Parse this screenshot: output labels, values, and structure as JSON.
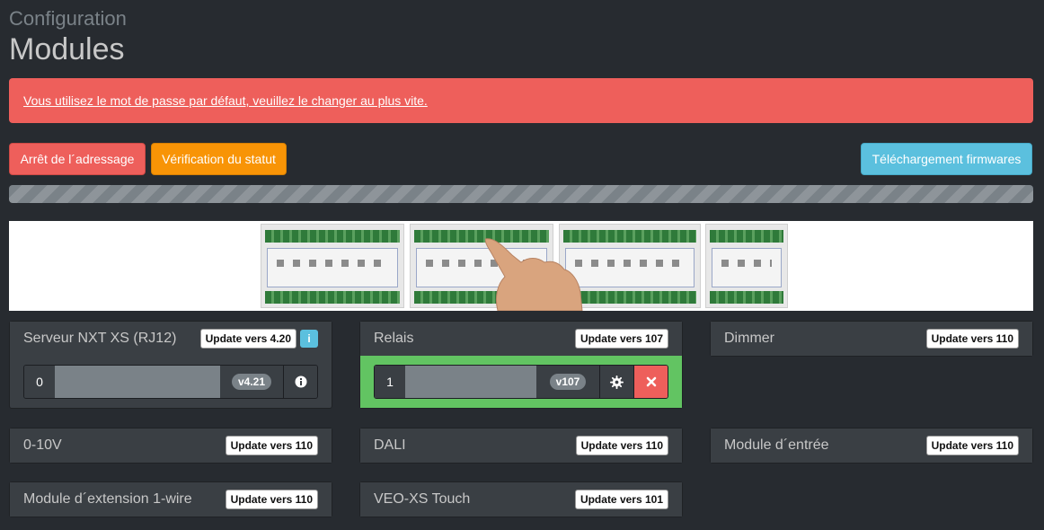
{
  "header": {
    "subtitle": "Configuration",
    "title": "Modules"
  },
  "alert": {
    "text": "Vous utilisez le mot de passe par défaut, veuillez le changer au plus vite."
  },
  "toolbar": {
    "stop_addressing": "Arrêt de l´adressage",
    "check_status": "Vérification du statut",
    "download_firmware": "Téléchargement firmwares"
  },
  "progress": {
    "percent": 100,
    "striped": true
  },
  "colors": {
    "danger": "#ee5f5b",
    "warning": "#f89406",
    "info": "#5bc0de",
    "success": "#62c462",
    "background": "#272b30",
    "panel": "#3a3f44"
  },
  "panels": {
    "server": {
      "title": "Serveur NXT XS (RJ12)",
      "update": "Update vers 4.20",
      "info_icon": "info-icon",
      "module": {
        "index": "0",
        "version": "v4.21",
        "action_icon": "info-icon"
      }
    },
    "relais": {
      "title": "Relais",
      "update": "Update vers 107",
      "module": {
        "index": "1",
        "version": "v107",
        "gear_icon": "gear-icon",
        "delete_icon": "close-icon"
      }
    },
    "dimmer": {
      "title": "Dimmer",
      "update": "Update vers 110"
    },
    "zero_ten": {
      "title": "0-10V",
      "update": "Update vers 110"
    },
    "dali": {
      "title": "DALI",
      "update": "Update vers 110"
    },
    "input": {
      "title": "Module d´entrée",
      "update": "Update vers 110"
    },
    "onewire": {
      "title": "Module d´extension 1-wire",
      "update": "Update vers 110"
    },
    "veo": {
      "title": "VEO-XS Touch",
      "update": "Update vers 101"
    }
  }
}
